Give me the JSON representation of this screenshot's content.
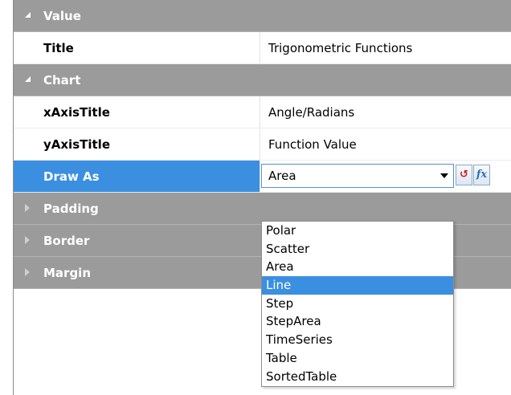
{
  "categories": {
    "value": "Value",
    "chart": "Chart",
    "padding": "Padding",
    "border": "Border",
    "margin": "Margin"
  },
  "properties": {
    "title": {
      "name": "Title",
      "value": "Trigonometric Functions"
    },
    "x_axis_title": {
      "name": "xAxisTitle",
      "value": "Angle/Radians"
    },
    "y_axis_title": {
      "name": "yAxisTitle",
      "value": "Function Value"
    },
    "draw_as": {
      "name": "Draw As",
      "value": "Area"
    }
  },
  "buttons": {
    "reset_glyph": "↺",
    "fx_glyph": "fx"
  },
  "dropdown": {
    "options": [
      "Polar",
      "Scatter",
      "Area",
      "Line",
      "Step",
      "StepArea",
      "TimeSeries",
      "Table",
      "SortedTable"
    ],
    "highlighted": "Line"
  },
  "colors": {
    "category_bg": "#9b9b9b",
    "selection": "#3b8fe0",
    "reset_red": "#d11a1a",
    "fx_blue": "#2d6fb8"
  }
}
